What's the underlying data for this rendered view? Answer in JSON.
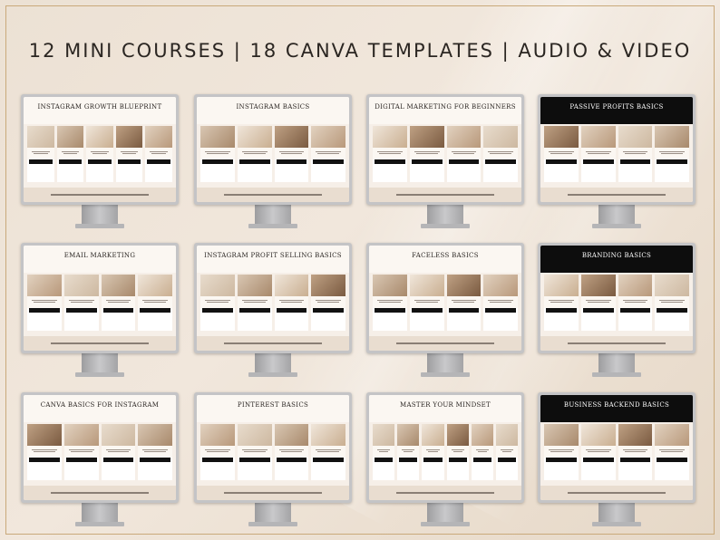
{
  "headline": "12 MINI COURSES | 18 CANVA TEMPLATES | AUDIO & VIDEO",
  "monitors": [
    {
      "title": "INSTAGRAM GROWTH BLUEPRINT",
      "theme": "light",
      "cards": 5
    },
    {
      "title": "INSTAGRAM BASICS",
      "theme": "light",
      "cards": 4
    },
    {
      "title": "DIGITAL MARKETING FOR BEGINNERS",
      "theme": "light",
      "cards": 4
    },
    {
      "title": "PASSIVE PROFITS BASICS",
      "theme": "dark",
      "cards": 4
    },
    {
      "title": "EMAIL MARKETING",
      "theme": "light",
      "cards": 4
    },
    {
      "title": "INSTAGRAM PROFIT SELLING BASICS",
      "theme": "light",
      "cards": 4
    },
    {
      "title": "FACELESS BASICS",
      "theme": "light",
      "cards": 4
    },
    {
      "title": "BRANDING BASICS",
      "theme": "dark",
      "cards": 4
    },
    {
      "title": "CANVA BASICS FOR INSTAGRAM",
      "theme": "light",
      "cards": 4
    },
    {
      "title": "PINTEREST BASICS",
      "theme": "light",
      "cards": 4
    },
    {
      "title": "MASTER YOUR MINDSET",
      "theme": "light",
      "cards": 6
    },
    {
      "title": "BUSINESS BACKEND BASICS",
      "theme": "dark",
      "cards": 4
    }
  ],
  "colors": {
    "background": "#ece1d4",
    "accent_frame": "#c9a97a",
    "text": "#2b2622"
  }
}
